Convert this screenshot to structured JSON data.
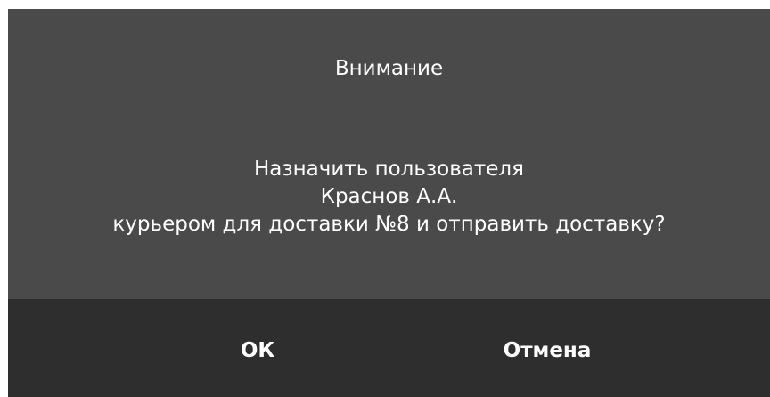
{
  "dialog": {
    "title": "Внимание",
    "message": {
      "line1": "Назначить пользователя",
      "line2": "Краснов А.А.",
      "line3": "курьером для доставки №8 и отправить доставку?"
    },
    "buttons": {
      "ok_label": "ОК",
      "cancel_label": "Отмена"
    }
  },
  "colors": {
    "dialog_background": "#4a4a4a",
    "footer_background": "#2e2e2e",
    "text": "#ffffff"
  }
}
